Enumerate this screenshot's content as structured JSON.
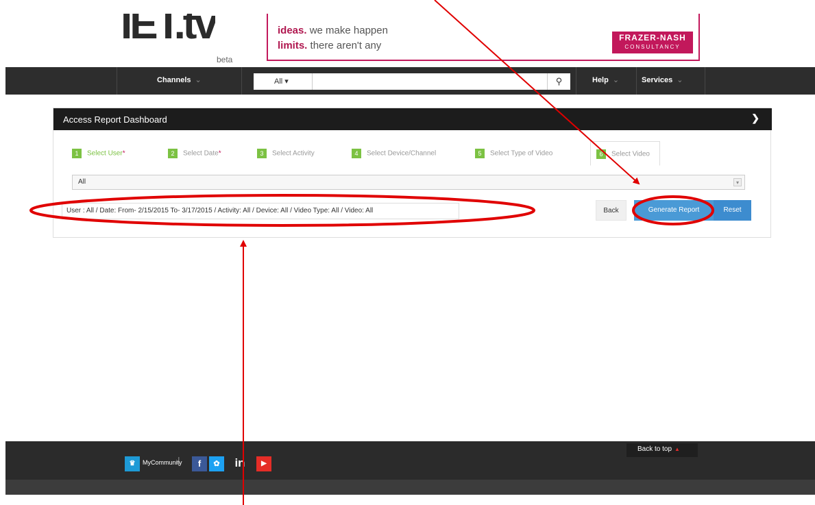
{
  "logo": {
    "mark": "IET.tv",
    "beta": "beta"
  },
  "ad": {
    "line1_bold": "ideas.",
    "line1_rest": " we make happen",
    "line2_bold": "limits.",
    "line2_rest": " there aren't any",
    "brand": "FRAZER-NASH",
    "brand_sub": "CONSULTANCY",
    "accent": "#c2185b"
  },
  "nav": {
    "channels": "Channels",
    "search_scope": "All",
    "search_placeholder": "",
    "search_icon": "search-icon",
    "help": "Help",
    "services": "Services"
  },
  "card": {
    "title": "Access Report Dashboard",
    "tabs": [
      {
        "num": "1",
        "label": "Select User",
        "required": "*"
      },
      {
        "num": "2",
        "label": "Select Date",
        "required": "*"
      },
      {
        "num": "3",
        "label": "Select Activity",
        "required": ""
      },
      {
        "num": "4",
        "label": "Select Device/Channel",
        "required": ""
      },
      {
        "num": "5",
        "label": "Select Type of Video",
        "required": ""
      },
      {
        "num": "6",
        "label": "Select Video",
        "required": ""
      }
    ],
    "select_value": "All",
    "summary": "User : All / Date: From- 2/15/2015 To- 3/17/2015 / Activity: All / Device: All / Video Type: All / Video: All",
    "back_label": "Back",
    "generate_label": "Generate Report",
    "reset_label": "Reset"
  },
  "footer": {
    "community": "MyCommunity",
    "back_to_top": "Back to top",
    "social": [
      "facebook-icon",
      "twitter-icon",
      "linkedin-icon",
      "youtube-icon"
    ]
  },
  "annotation_color": "#e00000"
}
